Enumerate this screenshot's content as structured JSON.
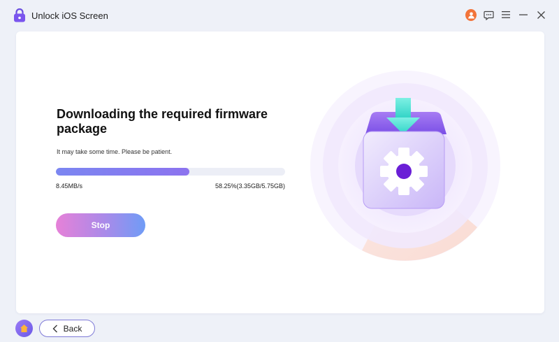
{
  "app": {
    "title": "Unlock iOS Screen"
  },
  "window_controls": {
    "icons": [
      "user-avatar-icon",
      "feedback-icon",
      "menu-icon",
      "minimize-icon",
      "close-icon"
    ]
  },
  "main": {
    "heading": "Downloading the required firmware package",
    "subtext": "It may take some time. Please be patient.",
    "progress": {
      "fraction": 0.5825,
      "speed": "8.45MB/s",
      "percent_text": "58.25%(3.35GB/5.75GB)"
    },
    "stop_label": "Stop"
  },
  "illustration": {
    "icon": "firmware-download-gear-icon"
  },
  "footer": {
    "back_label": "Back"
  },
  "colors": {
    "accent": "#7b86f1",
    "avatar": "#f2743a",
    "home": "#7a62ee"
  }
}
